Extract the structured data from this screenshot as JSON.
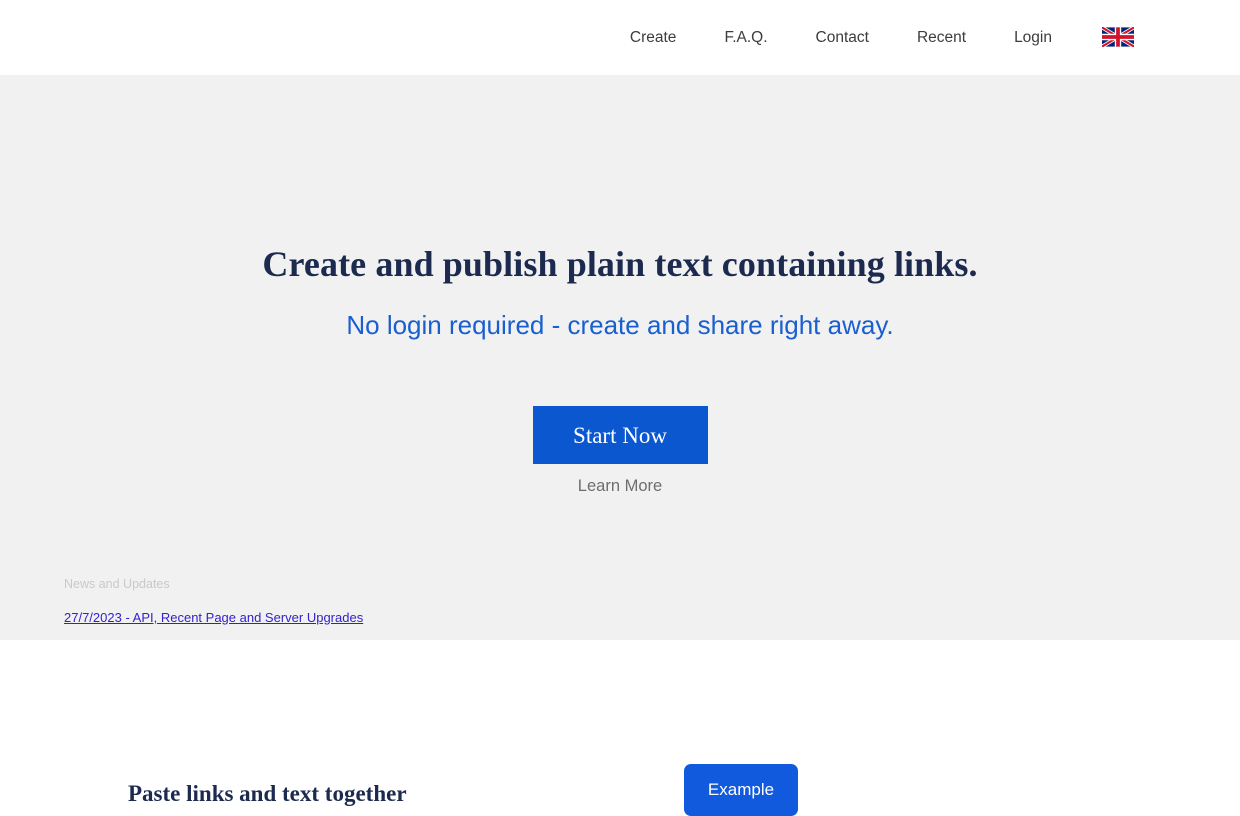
{
  "header": {
    "nav": [
      {
        "label": "Create",
        "name": "nav-item-create"
      },
      {
        "label": "F.A.Q.",
        "name": "nav-item-faq"
      },
      {
        "label": "Contact",
        "name": "nav-item-contact"
      },
      {
        "label": "Recent",
        "name": "nav-item-recent"
      },
      {
        "label": "Login",
        "name": "nav-item-login"
      }
    ],
    "language_flag": "uk-flag-icon"
  },
  "hero": {
    "headline": "Create and publish plain text containing links.",
    "subheadline": "No login required - create and share right away.",
    "primary_cta": "Start Now",
    "secondary_cta": "Learn More"
  },
  "news": {
    "title": "News and Updates",
    "items": [
      {
        "label": "27/7/2023 - API, Recent Page and Server Upgrades"
      }
    ]
  },
  "feature": {
    "heading": "Paste links and text together",
    "example_button": "Example"
  },
  "colors": {
    "header_bg": "#ffffff",
    "hero_bg": "#f1f1f1",
    "headline": "#1b2a4e",
    "subheadline": "#1a5fd0",
    "primary_button": "#0b57d0",
    "example_button": "#1159dd",
    "news_title": "#c9c9c9",
    "news_link": "#3322cc",
    "secondary_cta": "#6e6e6e",
    "nav_text": "#3c3c3c"
  }
}
